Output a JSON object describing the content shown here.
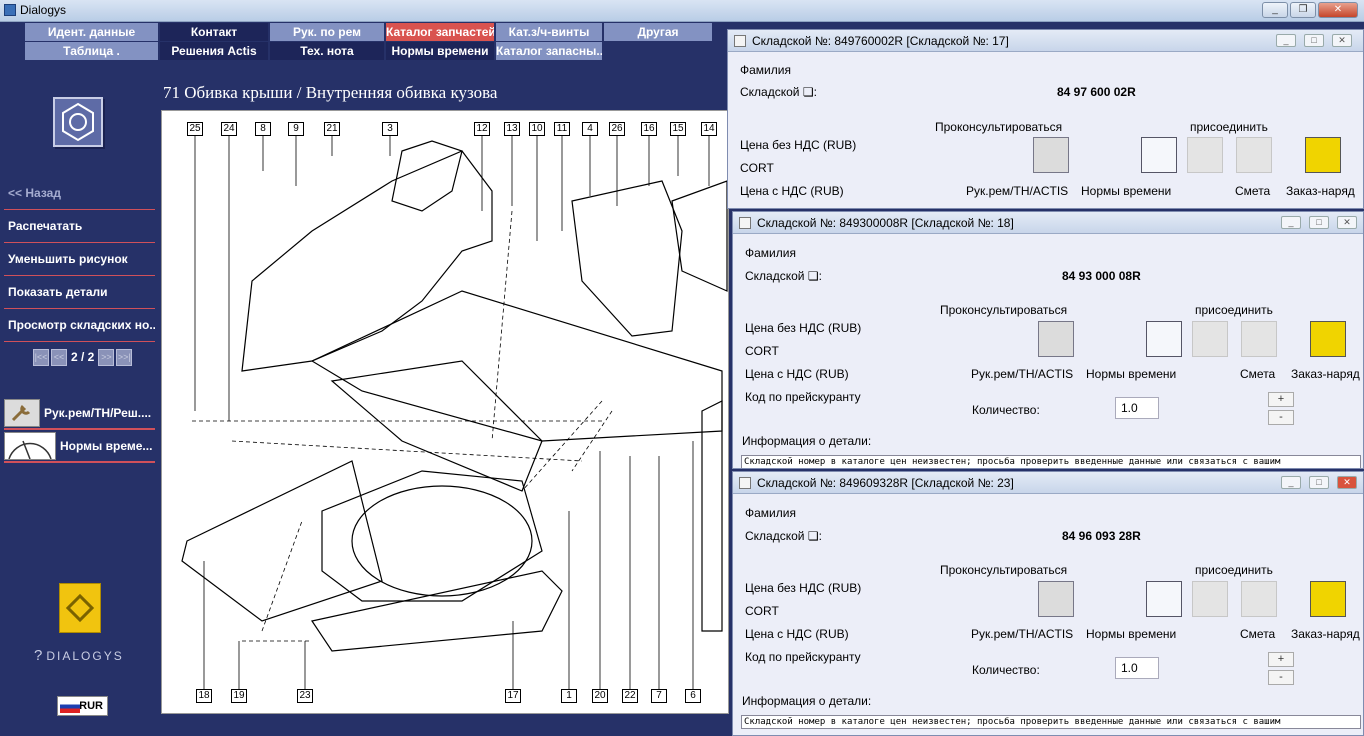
{
  "app": {
    "title": "Dialogys"
  },
  "menu_row1": [
    {
      "label": "Идент. данные",
      "style": "normal"
    },
    {
      "label": "Контакт",
      "style": "dark"
    },
    {
      "label": "Рук. по рем",
      "style": "normal"
    },
    {
      "label": "Каталог запчастей",
      "style": "red"
    },
    {
      "label": "Кат.з/ч-винты",
      "style": "normal"
    },
    {
      "label": "Другая",
      "style": "normal"
    }
  ],
  "menu_row2": [
    {
      "label": "Таблица .",
      "style": "normal"
    },
    {
      "label": "Решения Actis",
      "style": "dark"
    },
    {
      "label": "Тех. нота",
      "style": "dark"
    },
    {
      "label": "Нормы времени",
      "style": "dark"
    },
    {
      "label": "Каталог запасны...",
      "style": "normal"
    }
  ],
  "sidebar": {
    "items": [
      {
        "label": "<< Назад",
        "enabled": false
      },
      {
        "label": "Распечатать",
        "enabled": true
      },
      {
        "label": "Уменьшить рисунок",
        "enabled": true
      },
      {
        "label": "Показать детали",
        "enabled": true
      },
      {
        "label": "Просмотр складских но...",
        "enabled": true
      }
    ],
    "pager": {
      "first": "|<<",
      "prev": "<<",
      "text": "2 / 2",
      "next": ">>",
      "last": ">>|"
    },
    "tools": [
      {
        "label": "Рук.рем/ТН/Реш....",
        "icon": "wrench-manual-icon"
      },
      {
        "label": "Нормы време...",
        "icon": "clock-gauge-icon"
      }
    ],
    "brand": "DIALOGYS",
    "currency": "RUR"
  },
  "diagram": {
    "title": "71 Обивка крыши / Внутренняя обивка кузова",
    "callouts_top": [
      "25",
      "24",
      "8",
      "9",
      "21",
      "3",
      "12",
      "13",
      "10",
      "11",
      "4",
      "26",
      "16",
      "15",
      "14"
    ],
    "callouts_bottom": [
      "18",
      "19",
      "23",
      "17",
      "1",
      "20",
      "22",
      "7",
      "6"
    ]
  },
  "part_windows": [
    {
      "title": "Складской №: 849760002R [Складской №: 17]",
      "family_label": "Фамилия",
      "part_label": "Складской ❏:",
      "part_value": "84 97 600 02R",
      "consult_label": "Проконсультироваться",
      "attach_label": "присоединить",
      "price_no_vat": "Цена без НДС (RUB)",
      "cort": "CORT",
      "price_vat": "Цена с НДС (RUB)",
      "btn_manual": "Рук.рем/TH/ACTIS",
      "btn_times": "Нормы времени",
      "btn_estimate": "Смета",
      "btn_order": "Заказ-наряд"
    },
    {
      "title": "Складской №: 849300008R [Складской №: 18]",
      "family_label": "Фамилия",
      "part_label": "Складской ❏:",
      "part_value": "84 93 000 08R",
      "consult_label": "Проконсультироваться",
      "attach_label": "присоединить",
      "price_no_vat": "Цена без НДС (RUB)",
      "cort": "CORT",
      "price_vat": "Цена с НДС (RUB)",
      "price_code": "Код по прейскуранту",
      "btn_manual": "Рук.рем/TH/ACTIS",
      "btn_times": "Нормы времени",
      "btn_estimate": "Смета",
      "btn_order": "Заказ-наряд",
      "qty_label": "Количество:",
      "qty_value": "1.0",
      "plus": "+",
      "minus": "-",
      "info_label": "Информация о детали:",
      "info_text": "Складской номер в каталоге цен неизвестен; просьба проверить введенные данные или связаться с вашим"
    },
    {
      "title": "Складской №: 849609328R [Складской №: 23]",
      "family_label": "Фамилия",
      "part_label": "Складской ❏:",
      "part_value": "84 96 093 28R",
      "consult_label": "Проконсультироваться",
      "attach_label": "присоединить",
      "price_no_vat": "Цена без НДС (RUB)",
      "cort": "CORT",
      "price_vat": "Цена с НДС (RUB)",
      "price_code": "Код по прейскуранту",
      "btn_manual": "Рук.рем/TH/ACTIS",
      "btn_times": "Нормы времени",
      "btn_estimate": "Смета",
      "btn_order": "Заказ-наряд",
      "qty_label": "Количество:",
      "qty_value": "1.0",
      "plus": "+",
      "minus": "-",
      "info_label": "Информация о детали:",
      "info_text": "Складской номер в каталоге цен неизвестен; просьба проверить введенные данные или связаться с вашим"
    }
  ]
}
